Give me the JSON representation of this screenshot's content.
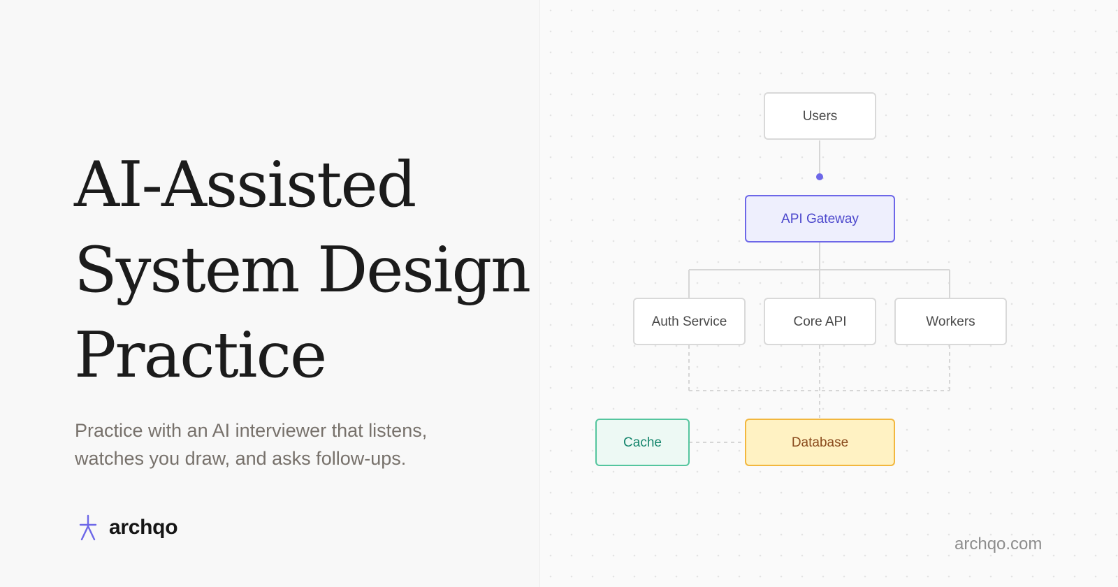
{
  "hero": {
    "title_lines": [
      "AI-Assisted",
      "System Design",
      "Practice"
    ],
    "subtitle_lines": [
      "Practice with an AI interviewer that listens,",
      "watches you draw, and asks follow-ups."
    ]
  },
  "brand": {
    "name": "archqo",
    "icon": "stick-figure-icon",
    "accent_color": "#6d67e8"
  },
  "diagram": {
    "nodes": {
      "users": "Users",
      "api_gateway": "API Gateway",
      "auth_service": "Auth Service",
      "core_api": "Core API",
      "workers": "Workers",
      "cache": "Cache",
      "database": "Database"
    },
    "colors": {
      "default_border": "#d9d9d9",
      "api_border": "#6d67e8",
      "api_fill": "#eeeffd",
      "cache_border": "#55c59e",
      "cache_fill": "#edf9f4",
      "database_border": "#f2b73e",
      "database_fill": "#fff2c3"
    }
  },
  "footer": {
    "domain": "archqo.com"
  }
}
